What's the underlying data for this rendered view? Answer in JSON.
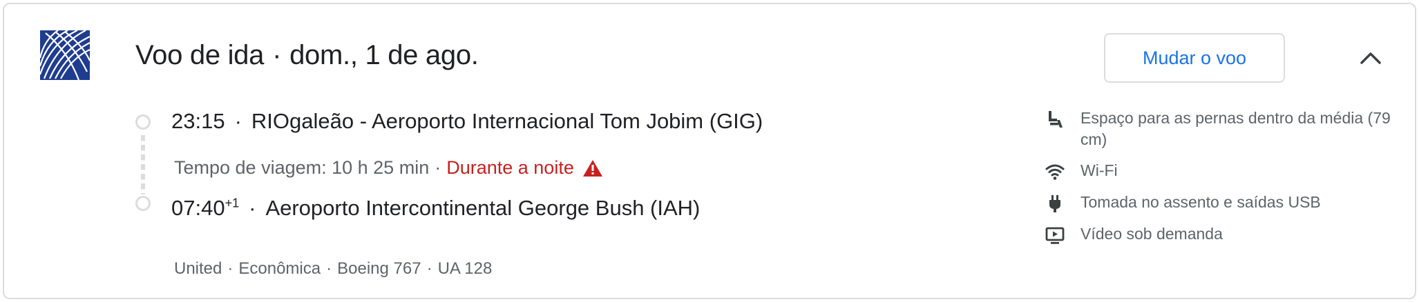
{
  "header": {
    "title_prefix": "Voo de ida",
    "title_sep": "·",
    "title_date": "dom., 1 de ago.",
    "change_button": "Mudar o voo"
  },
  "departure": {
    "time": "23:15",
    "sep": "·",
    "airport": "RIOgaleão - Aeroporto Internacional Tom Jobim (GIG)"
  },
  "duration": {
    "label": "Tempo de viagem: 10 h 25 min",
    "sep": "·",
    "overnight": "Durante a noite"
  },
  "arrival": {
    "time": "07:40",
    "day_offset": "+1",
    "sep": "·",
    "airport": "Aeroporto Intercontinental George Bush (IAH)"
  },
  "details": {
    "airline": "United",
    "cabin": "Econômica",
    "aircraft": "Boeing 767",
    "flight": "UA 128",
    "sep": "·"
  },
  "amenities": [
    {
      "icon": "legroom-icon",
      "label": "Espaço para as pernas dentro da média (79 cm)"
    },
    {
      "icon": "wifi-icon",
      "label": "Wi-Fi"
    },
    {
      "icon": "power-plug-icon",
      "label": "Tomada no assento e saídas USB"
    },
    {
      "icon": "video-icon",
      "label": "Vídeo sob demanda"
    }
  ],
  "colors": {
    "accent": "#1a73e8",
    "warning": "#c5221f",
    "logo_bg": "#1f3d8f",
    "secondary_text": "#5f6368",
    "border": "#dadce0"
  }
}
